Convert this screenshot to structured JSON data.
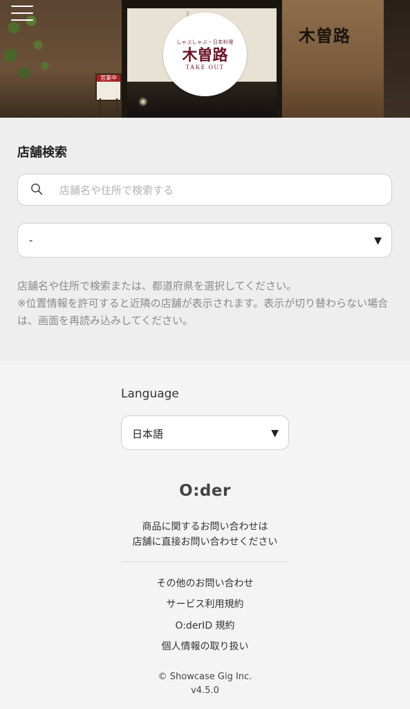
{
  "hero": {
    "logo": {
      "tagline": "しゃぶしゃぶ・日本料理",
      "name": "木曽路",
      "subtitle": "TAKE OUT"
    },
    "storefront_sign": "木曽路",
    "stand_sign": "営業中",
    "menu_icon": "hamburger-menu-icon"
  },
  "search": {
    "title": "店舗検索",
    "placeholder": "店舗名や住所で検索する",
    "search_icon": "search-icon",
    "prefecture_value": "-",
    "help_lines": [
      "店舗名や住所で検索または、都道府県を選択してください。",
      "※位置情報を許可すると近隣の店舗が表示されます。表示が切り替わらない場合は、画面を再読み込みしてください。"
    ]
  },
  "footer": {
    "language_label": "Language",
    "language_value": "日本語",
    "brand": "O:der",
    "contact_note": [
      "商品に関するお問い合わせは",
      "店舗に直接お問い合わせください"
    ],
    "links": [
      "その他のお問い合わせ",
      "サービス利用規約",
      "O:derID 規約",
      "個人情報の取り扱い"
    ],
    "copyright": "© Showcase Gig Inc.",
    "version": "v4.5.0"
  },
  "colors": {
    "search_bg": "#eeeeee",
    "footer_bg": "#f4f4f4",
    "help_text": "#8a8a8a",
    "logo_accent": "#6b1428"
  }
}
